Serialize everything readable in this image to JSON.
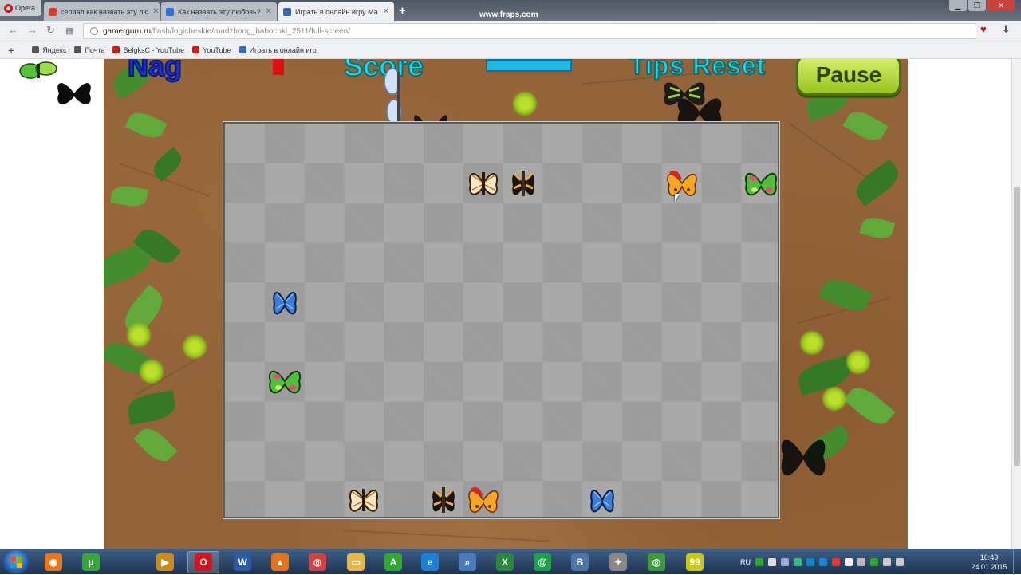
{
  "browser": {
    "menu_label": "Opera",
    "tabs": [
      {
        "label": "сериал как назвать эту лю",
        "favicon_color": "#e23a2c"
      },
      {
        "label": "Как назвать эту любовь?",
        "favicon_color": "#2f6fd6"
      },
      {
        "label": "Играть в онлайн игру Ма",
        "favicon_color": "#3b67b4",
        "active": true
      }
    ],
    "new_tab_label": "+",
    "overlay": "www.fraps.com",
    "url_host": "gamerguru.ru",
    "url_path": "/flash/logicheskie/madzhong_babochki_2511/full-screen/",
    "bookmarks_add": "+",
    "bookmarks": [
      {
        "label": "Яндекс",
        "icon_color": "#555"
      },
      {
        "label": "Почта",
        "icon_color": "#555"
      },
      {
        "label": "BelgksC - YouTube",
        "icon_color": "#d21818"
      },
      {
        "label": "YouTube",
        "icon_color": "#d21818"
      },
      {
        "label": "Играть в онлайн игр",
        "icon_color": "#3b67b4"
      }
    ]
  },
  "game": {
    "hud_left": "Nag",
    "hud_score_label": "Score",
    "hud_tips": "Tips Reset",
    "pause_label": "Pause",
    "butterflies": [
      {
        "kind": "monarch-white",
        "col": 6,
        "row": 1
      },
      {
        "kind": "swallowtail-black",
        "col": 7,
        "row": 1
      },
      {
        "kind": "orange-red",
        "col": 11,
        "row": 1
      },
      {
        "kind": "green-pink",
        "col": 13,
        "row": 1
      },
      {
        "kind": "blue-morpho",
        "col": 1,
        "row": 4
      },
      {
        "kind": "green-pink",
        "col": 1,
        "row": 6
      },
      {
        "kind": "monarch-white",
        "col": 3,
        "row": 9
      },
      {
        "kind": "swallowtail-black",
        "col": 5,
        "row": 9
      },
      {
        "kind": "orange-red",
        "col": 6,
        "row": 9
      },
      {
        "kind": "blue-morpho",
        "col": 9,
        "row": 9
      }
    ]
  },
  "taskbar": {
    "language": "RU",
    "time": "16:43",
    "date": "24.01.2015",
    "apps": [
      {
        "name": "firefox",
        "glyph": "◉",
        "color": "#e8761a"
      },
      {
        "name": "utorrent",
        "glyph": "µ",
        "color": "#3aa53a"
      },
      {
        "name": "media-player",
        "glyph": "▶",
        "color": "#cc8a1a"
      },
      {
        "name": "opera",
        "glyph": "O",
        "color": "#d2141e",
        "active": true
      },
      {
        "name": "word",
        "glyph": "W",
        "color": "#2a5aa8"
      },
      {
        "name": "avast",
        "glyph": "▲",
        "color": "#e6731a"
      },
      {
        "name": "chrome-ball",
        "glyph": "◎",
        "color": "#c44"
      },
      {
        "name": "explorer",
        "glyph": "▭",
        "color": "#e5b946"
      },
      {
        "name": "a-app",
        "glyph": "A",
        "color": "#2fa82f"
      },
      {
        "name": "ie",
        "glyph": "e",
        "color": "#1d7fd6"
      },
      {
        "name": "network",
        "glyph": "⌕",
        "color": "#4a7ab8"
      },
      {
        "name": "excel",
        "glyph": "X",
        "color": "#2a8a3a"
      },
      {
        "name": "mail",
        "glyph": "@",
        "color": "#1fa04a"
      },
      {
        "name": "vk",
        "glyph": "B",
        "color": "#4a76a8"
      },
      {
        "name": "game",
        "glyph": "✦",
        "color": "#888"
      },
      {
        "name": "chrome",
        "glyph": "◎",
        "color": "#3c9c3c"
      },
      {
        "name": "fraps",
        "glyph": "99",
        "color": "#c8c81a"
      }
    ]
  },
  "colors": {
    "board_dark": "#9d9d9d",
    "board_light": "#a9a9a9",
    "pause_green": "#96c41c"
  }
}
